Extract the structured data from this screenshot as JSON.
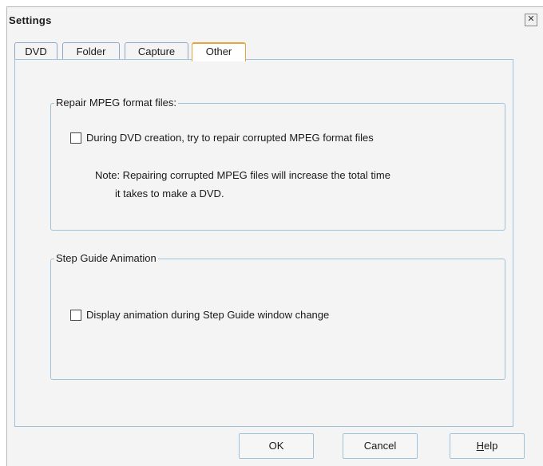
{
  "window": {
    "title": "Settings",
    "close_glyph": "✕"
  },
  "tabs": [
    {
      "label": "DVD",
      "active": false
    },
    {
      "label": "Folder",
      "active": false
    },
    {
      "label": "Capture",
      "active": false
    },
    {
      "label": "Other",
      "active": true
    }
  ],
  "repair_group": {
    "label": "Repair MPEG format files:",
    "checkbox_label": "During DVD creation, try to repair corrupted MPEG format files",
    "checked": false,
    "note_line1": "Note: Repairing corrupted MPEG files will increase the total time",
    "note_line2": "it takes to make a DVD."
  },
  "animation_group": {
    "label": "Step Guide Animation",
    "checkbox_label": "Display animation during Step Guide window change",
    "checked": false
  },
  "buttons": {
    "ok": "OK",
    "cancel": "Cancel",
    "help_underlined": "H",
    "help_rest": "elp"
  },
  "colors": {
    "accent_tab": "#e8a43c",
    "frame_border": "#9fc2d8",
    "background": "#f4f4f4"
  }
}
